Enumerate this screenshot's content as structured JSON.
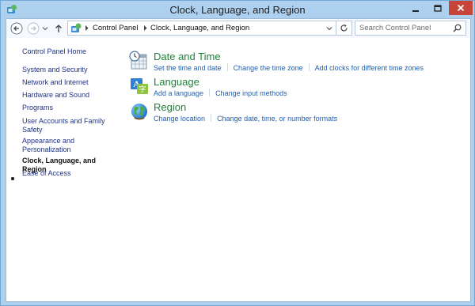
{
  "window": {
    "title": "Clock, Language, and Region"
  },
  "navigation": {
    "breadcrumb": [
      "Control Panel",
      "Clock, Language, and Region"
    ],
    "search_placeholder": "Search Control Panel"
  },
  "sidebar": {
    "home": "Control Panel Home",
    "items": [
      {
        "label": "System and Security"
      },
      {
        "label": "Network and Internet"
      },
      {
        "label": "Hardware and Sound"
      },
      {
        "label": "Programs"
      },
      {
        "label": "User Accounts and Family Safety"
      },
      {
        "label": "Appearance and Personalization"
      },
      {
        "label": "Clock, Language, and Region",
        "active": true
      },
      {
        "label": "Ease of Access"
      }
    ]
  },
  "categories": [
    {
      "title": "Date and Time",
      "icon": "clock-calendar-icon",
      "links": [
        "Set the time and date",
        "Change the time zone",
        "Add clocks for different time zones"
      ]
    },
    {
      "title": "Language",
      "icon": "language-icon",
      "links": [
        "Add a language",
        "Change input methods"
      ]
    },
    {
      "title": "Region",
      "icon": "globe-icon",
      "links": [
        "Change location",
        "Change date, time, or number formats"
      ]
    }
  ],
  "colors": {
    "title_bar": "#aed0ef",
    "category_title": "#22803a",
    "link": "#1f5fb0",
    "sidebar_link": "#1e3287",
    "close_button": "#c7443b"
  }
}
